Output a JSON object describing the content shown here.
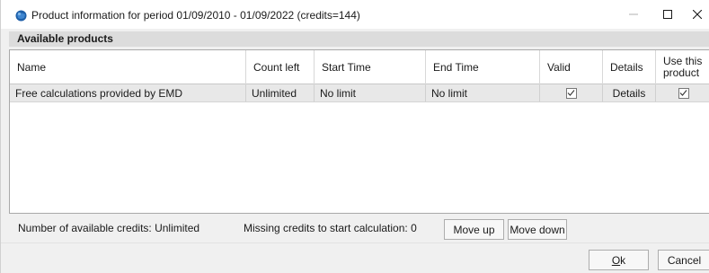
{
  "window": {
    "title": "Product information for period 01/09/2010 - 01/09/2022 (credits=144)",
    "icon": "globe-app-icon"
  },
  "section": {
    "title": "Available products"
  },
  "table": {
    "columns": [
      "Name",
      "Count left",
      "Start Time",
      "End Time",
      "Valid",
      "Details",
      "Use this product"
    ],
    "rows": [
      {
        "name": "Free calculations provided by EMD",
        "count_left": "Unlimited",
        "start_time": "No limit",
        "end_time": "No limit",
        "valid": true,
        "details": "Details",
        "use_this_product": true
      }
    ]
  },
  "status": {
    "credits": "Number of available credits: Unlimited",
    "missing": "Missing credits to start calculation: 0"
  },
  "buttons": {
    "move_up": "Move up",
    "move_down": "Move down",
    "ok_underlined": "O",
    "ok_rest": "k",
    "cancel": "Cancel"
  },
  "colors": {
    "selected_row": "#e8e8e8",
    "section_header": "#dcdcdc",
    "dialog_background": "#f0f0f0",
    "icon_blue": "#1e5fa8"
  }
}
